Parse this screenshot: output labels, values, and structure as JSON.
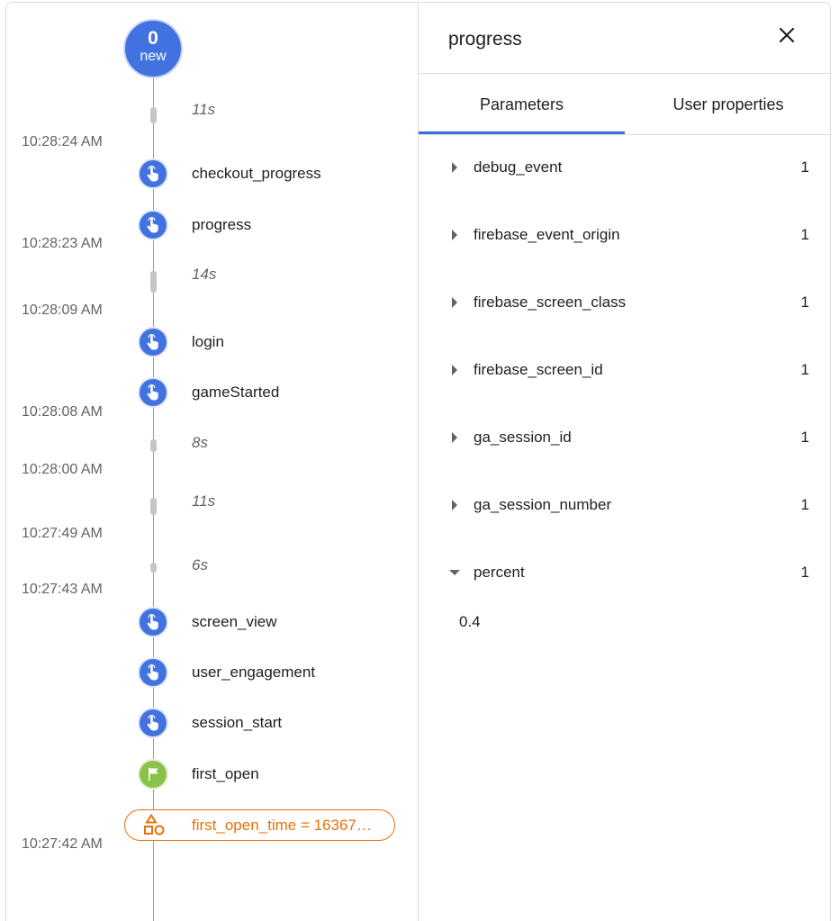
{
  "timeline": {
    "new_badge": {
      "count": "0",
      "label": "new"
    },
    "timestamps": [
      "10:28:24 AM",
      "10:28:23 AM",
      "10:28:09 AM",
      "10:28:08 AM",
      "10:28:00 AM",
      "10:27:49 AM",
      "10:27:43 AM",
      "10:27:42 AM"
    ],
    "gaps": [
      "11s",
      "14s",
      "8s",
      "11s",
      "6s"
    ],
    "events": [
      {
        "name": "checkout_progress",
        "icon": "touch-icon"
      },
      {
        "name": "progress",
        "icon": "touch-icon"
      },
      {
        "name": "login",
        "icon": "touch-icon"
      },
      {
        "name": "gameStarted",
        "icon": "touch-icon"
      },
      {
        "name": "screen_view",
        "icon": "touch-icon"
      },
      {
        "name": "user_engagement",
        "icon": "touch-icon"
      },
      {
        "name": "session_start",
        "icon": "touch-icon"
      },
      {
        "name": "first_open",
        "icon": "flag-icon"
      }
    ],
    "user_property": {
      "text": "first_open_time = 16367…",
      "icon": "shapes-icon"
    }
  },
  "panel": {
    "title": "progress",
    "tabs": [
      "Parameters",
      "User properties"
    ],
    "active_tab": "Parameters",
    "params": [
      {
        "name": "debug_event",
        "count": "1",
        "expanded": false
      },
      {
        "name": "firebase_event_origin",
        "count": "1",
        "expanded": false
      },
      {
        "name": "firebase_screen_class",
        "count": "1",
        "expanded": false
      },
      {
        "name": "firebase_screen_id",
        "count": "1",
        "expanded": false
      },
      {
        "name": "ga_session_id",
        "count": "1",
        "expanded": false
      },
      {
        "name": "ga_session_number",
        "count": "1",
        "expanded": false
      },
      {
        "name": "percent",
        "count": "1",
        "expanded": true,
        "value": "0.4"
      }
    ]
  },
  "colors": {
    "accent_blue": "#4172e0",
    "tab_indicator": "#3a70db",
    "flag_green": "#8bc34a",
    "user_property_orange": "#e8710a"
  }
}
